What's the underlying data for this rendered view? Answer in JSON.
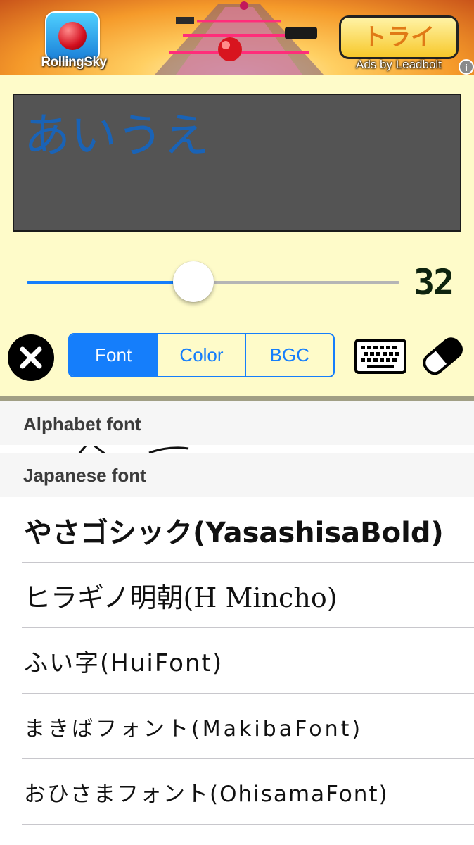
{
  "ad": {
    "app_name": "RollingSky",
    "button_label": "トライ",
    "attribution": "Ads by Leadbolt",
    "info_label": "i"
  },
  "preview": {
    "text": "あいうえ",
    "text_color": "#1a63b6",
    "background_color": "#545454"
  },
  "size_slider": {
    "value": 32,
    "value_label": "32",
    "fraction": 0.44
  },
  "segments": {
    "selected": "Font",
    "items": [
      "Font",
      "Color",
      "BGC"
    ]
  },
  "sections": {
    "alphabet": "Alphabet font",
    "japanese": "Japanese font"
  },
  "fonts": [
    "やさゴシック(YasashisaBold)",
    "ヒラギノ明朝(H Mincho)",
    "ふい字(HuiFont)",
    "まきばフォント(MakibaFont)",
    "おひさまフォント(OhisamaFont)"
  ],
  "colors": {
    "accent": "#157efb",
    "panel_background": "#fefbc9",
    "section_background": "#f6f6f6"
  }
}
